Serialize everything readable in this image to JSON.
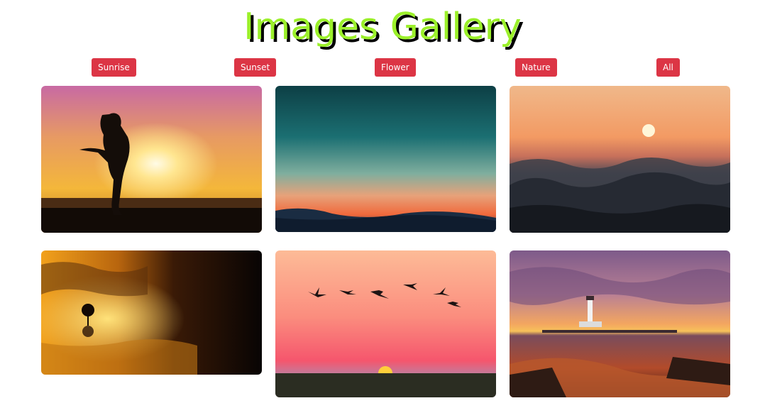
{
  "header": {
    "title": "Images Gallery"
  },
  "filters": [
    {
      "label": "Sunrise"
    },
    {
      "label": "Sunset"
    },
    {
      "label": "Flower"
    },
    {
      "label": "Nature"
    },
    {
      "label": "All"
    }
  ],
  "theme": {
    "title_color": "#9bf02a",
    "title_shadow": "#000000",
    "button_color": "#dc3545",
    "button_text": "#ffffff"
  },
  "gallery": {
    "images": [
      {
        "subject": "woman-silhouette-sunrise-photo"
      },
      {
        "subject": "teal-orange-sunset-sky-photo"
      },
      {
        "subject": "sunset-over-waves-photo"
      },
      {
        "subject": "tree-reflection-sunset-photo"
      },
      {
        "subject": "birds-pink-sky-sunset-photo"
      },
      {
        "subject": "lighthouse-sunset-photo"
      }
    ]
  }
}
